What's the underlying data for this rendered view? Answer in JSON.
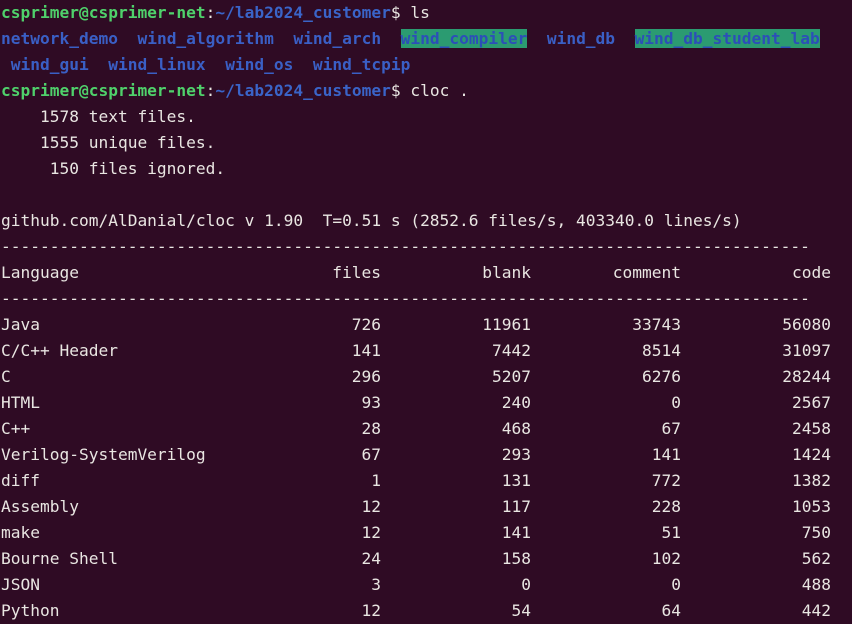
{
  "prompt": {
    "user_host": "csprimer@csprimer-net",
    "sep": ":",
    "path": "~/lab2024_customer",
    "symbol": "$"
  },
  "commands": [
    "ls",
    "cloc ."
  ],
  "ls_row1": [
    {
      "name": "network_demo",
      "hl": false
    },
    {
      "name": "wind_algorithm",
      "hl": false
    },
    {
      "name": "wind_arch",
      "hl": false
    },
    {
      "name": "wind_compiler",
      "hl": true
    },
    {
      "name": "wind_db",
      "hl": false
    },
    {
      "name": "wind_db_student_lab",
      "hl": true
    }
  ],
  "ls_row2": [
    {
      "name": "wind_gui",
      "hl": false
    },
    {
      "name": "wind_linux",
      "hl": false
    },
    {
      "name": "wind_os",
      "hl": false
    },
    {
      "name": "wind_tcpip",
      "hl": false
    }
  ],
  "summary": {
    "text_files": "    1578 text files.",
    "unique_files": "    1555 unique files.",
    "ignored": "     150 files ignored."
  },
  "version_line": "github.com/AlDanial/cloc v 1.90  T=0.51 s (2852.6 files/s, 403340.0 lines/s)",
  "separator": "-----------------------------------------------------------------------------------",
  "table": {
    "headers": [
      "Language",
      "files",
      "blank",
      "comment",
      "code"
    ],
    "rows": [
      [
        "Java",
        "726",
        "11961",
        "33743",
        "56080"
      ],
      [
        "C/C++ Header",
        "141",
        "7442",
        "8514",
        "31097"
      ],
      [
        "C",
        "296",
        "5207",
        "6276",
        "28244"
      ],
      [
        "HTML",
        "93",
        "240",
        "0",
        "2567"
      ],
      [
        "C++",
        "28",
        "468",
        "67",
        "2458"
      ],
      [
        "Verilog-SystemVerilog",
        "67",
        "293",
        "141",
        "1424"
      ],
      [
        "diff",
        "1",
        "131",
        "772",
        "1382"
      ],
      [
        "Assembly",
        "12",
        "117",
        "228",
        "1053"
      ],
      [
        "make",
        "12",
        "141",
        "51",
        "750"
      ],
      [
        "Bourne Shell",
        "24",
        "158",
        "102",
        "562"
      ],
      [
        "JSON",
        "3",
        "0",
        "0",
        "488"
      ],
      [
        "Python",
        "12",
        "54",
        "64",
        "442"
      ]
    ]
  },
  "colors": {
    "background": "#2f0b24",
    "prompt_user": "#4fd16b",
    "prompt_path": "#3a64c8",
    "dir_highlight": "#2b9b71"
  }
}
